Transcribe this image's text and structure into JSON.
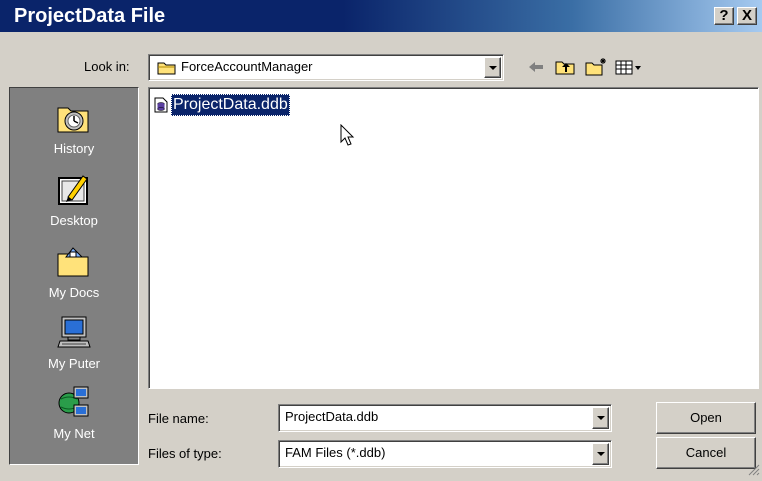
{
  "window": {
    "title": "ProjectData File",
    "help_button": "?",
    "close_button": "X",
    "titlebar_color": "#0a246a"
  },
  "toolbar": {
    "lookin_label": "Look in:",
    "lookin_value": "ForceAccountManager",
    "icons": [
      "back-arrow-icon",
      "up-one-level-icon",
      "create-new-folder-icon",
      "view-menu-icon"
    ]
  },
  "places": [
    {
      "label": "History",
      "icon": "history-icon"
    },
    {
      "label": "Desktop",
      "icon": "desktop-icon"
    },
    {
      "label": "My Docs",
      "icon": "my-documents-icon"
    },
    {
      "label": "My Puter",
      "icon": "my-computer-icon"
    },
    {
      "label": "My Net",
      "icon": "network-places-icon"
    }
  ],
  "files": [
    {
      "name": "ProjectData.ddb",
      "selected": true,
      "icon": "database-file-icon"
    }
  ],
  "form": {
    "filename_label": "File name:",
    "filename_value": "ProjectData.ddb",
    "filetype_label": "Files of type:",
    "filetype_value": "FAM Files (*.ddb)"
  },
  "buttons": {
    "open": "Open",
    "cancel": "Cancel"
  },
  "colors": {
    "face": "#d4d0c8",
    "selection": "#0a246a",
    "places_bg": "#808080"
  }
}
